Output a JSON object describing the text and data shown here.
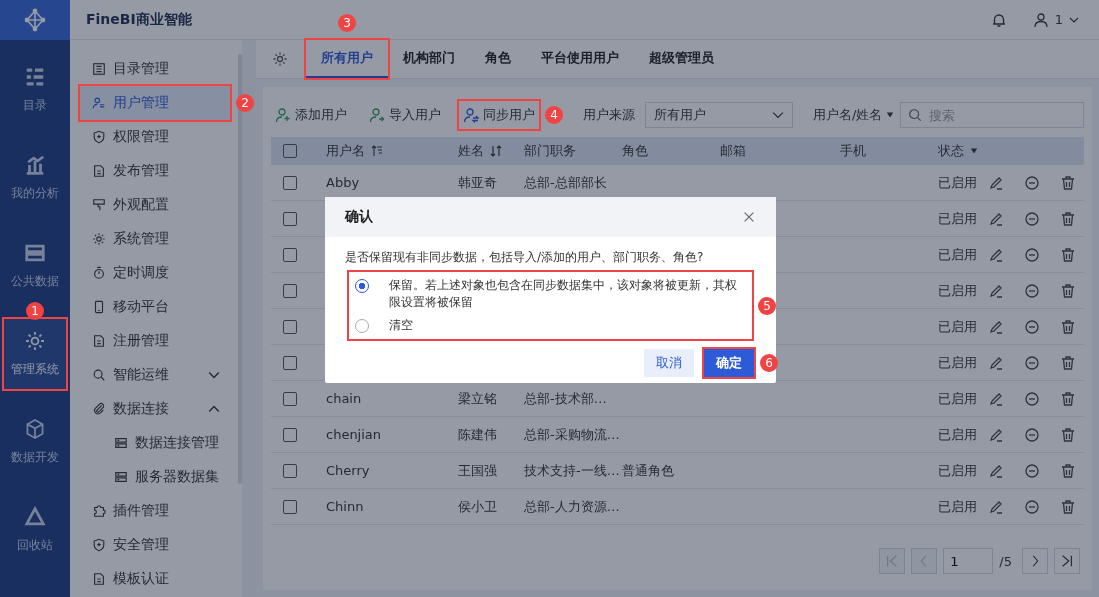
{
  "app_title": "FineBI商业智能",
  "header": {
    "user": "1"
  },
  "rail": [
    {
      "label": "目录",
      "selected": false
    },
    {
      "label": "我的分析",
      "selected": false
    },
    {
      "label": "公共数据",
      "selected": false
    },
    {
      "label": "管理系统",
      "selected": true,
      "callout": "1"
    },
    {
      "label": "数据开发",
      "selected": false
    },
    {
      "label": "回收站",
      "selected": false
    }
  ],
  "nav": [
    {
      "label": "目录管理",
      "selected": false
    },
    {
      "label": "用户管理",
      "selected": true,
      "callout": "2"
    },
    {
      "label": "权限管理",
      "selected": false
    },
    {
      "label": "发布管理",
      "selected": false
    },
    {
      "label": "外观配置",
      "selected": false
    },
    {
      "label": "系统管理",
      "selected": false
    },
    {
      "label": "定时调度",
      "selected": false
    },
    {
      "label": "移动平台",
      "selected": false
    },
    {
      "label": "注册管理",
      "selected": false
    },
    {
      "label": "智能运维",
      "selected": false,
      "expanded": false
    },
    {
      "label": "数据连接",
      "selected": false,
      "expanded": true,
      "children": [
        {
          "label": "数据连接管理",
          "selected": false
        },
        {
          "label": "服务器数据集",
          "selected": false
        }
      ]
    },
    {
      "label": "插件管理",
      "selected": false
    },
    {
      "label": "安全管理",
      "selected": false
    },
    {
      "label": "模板认证",
      "selected": false
    }
  ],
  "tabs": [
    {
      "label": "所有用户",
      "selected": true,
      "callout": "3"
    },
    {
      "label": "机构部门",
      "selected": false
    },
    {
      "label": "角色",
      "selected": false
    },
    {
      "label": "平台使用用户",
      "selected": false
    },
    {
      "label": "超级管理员",
      "selected": false
    }
  ],
  "toolbar": {
    "actions": [
      {
        "label": "添加用户",
        "kind": "add"
      },
      {
        "label": "导入用户",
        "kind": "import"
      },
      {
        "label": "同步用户",
        "kind": "sync",
        "callout": "4"
      }
    ],
    "source_label": "用户来源",
    "source_value": "所有用户",
    "search_scope": "用户名/姓名",
    "search_placeholder": "搜索"
  },
  "table": {
    "header_checked": false,
    "columns": [
      {
        "label": "用户名",
        "kind": "filter-sort"
      },
      {
        "label": "姓名",
        "kind": "sort"
      },
      {
        "label": "部门职务",
        "kind": "plain"
      },
      {
        "label": "角色",
        "kind": "plain"
      },
      {
        "label": "邮箱",
        "kind": "plain"
      },
      {
        "label": "手机",
        "kind": "plain"
      },
      {
        "label": "状态",
        "kind": "dropdown"
      }
    ],
    "rows": [
      {
        "checked": false,
        "username": "Abby",
        "name": "韩亚奇",
        "dept": "总部-总部部长",
        "status": "已启用"
      },
      {
        "checked": false,
        "status": "已启用"
      },
      {
        "checked": false,
        "status": "已启用"
      },
      {
        "checked": false,
        "status": "已启用"
      },
      {
        "checked": false,
        "status": "已启用"
      },
      {
        "checked": false,
        "status": "已启用"
      },
      {
        "checked": false,
        "username": "chain",
        "name": "梁立铭",
        "dept": "总部-技术部…",
        "status": "已启用"
      },
      {
        "checked": false,
        "username": "chenjian",
        "name": "陈建伟",
        "dept": "总部-采购物流…",
        "status": "已启用"
      },
      {
        "checked": false,
        "username": "Cherry",
        "name": "王国强",
        "dept": "技术支持-一线…",
        "role": "普通角色",
        "status": "已启用"
      },
      {
        "checked": false,
        "username": "Chinn",
        "name": "侯小卫",
        "dept": "总部-人力资源…",
        "status": "已启用"
      }
    ]
  },
  "pagination": {
    "page": "1",
    "total": "/5"
  },
  "dialog": {
    "title": "确认",
    "question": "是否保留现有非同步数据，包括导入/添加的用户、部门职务、角色?",
    "options": [
      {
        "label": "保留。若上述对象也包含在同步数据集中，该对象将被更新，其权限设置将被保留",
        "selected": true
      },
      {
        "label": "清空",
        "selected": false
      }
    ],
    "options_callout": "5",
    "buttons": [
      {
        "label": "取消",
        "kind": "secondary"
      },
      {
        "label": "确定",
        "kind": "primary",
        "callout": "6"
      }
    ]
  }
}
